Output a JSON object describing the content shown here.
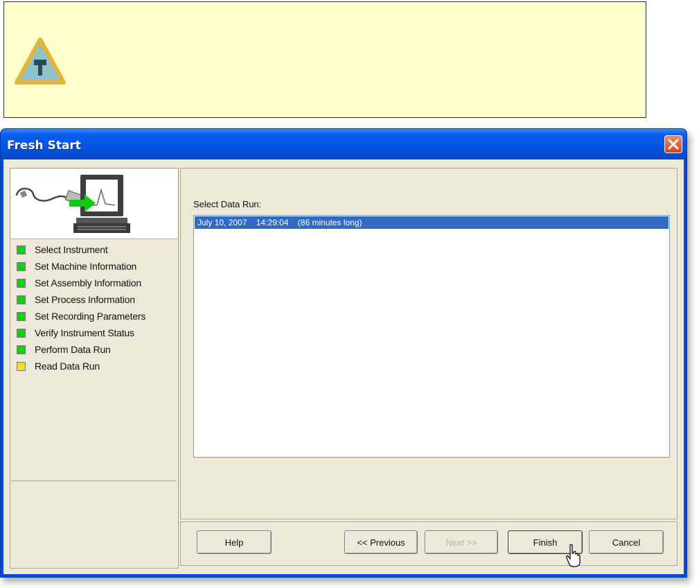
{
  "note": {
    "icon": "hammer-tip-icon"
  },
  "dialog": {
    "title": "Fresh Start",
    "close_icon": "close-icon"
  },
  "steps": [
    {
      "label": "Select Instrument",
      "status": "complete",
      "color": "#10d010"
    },
    {
      "label": "Set Machine Information",
      "status": "complete",
      "color": "#10d010"
    },
    {
      "label": "Set Assembly Information",
      "status": "complete",
      "color": "#10d010"
    },
    {
      "label": "Set Process Information",
      "status": "complete",
      "color": "#10d010"
    },
    {
      "label": "Set Recording Parameters",
      "status": "complete",
      "color": "#10d010"
    },
    {
      "label": "Verify Instrument Status",
      "status": "complete",
      "color": "#10d010"
    },
    {
      "label": "Perform Data Run",
      "status": "complete",
      "color": "#10d010"
    },
    {
      "label": "Read Data Run",
      "status": "current",
      "color": "#f0e020"
    }
  ],
  "data_run": {
    "label": "Select Data Run:",
    "items": [
      {
        "text": "July 10, 2007    14:29:04    (86 minutes long)",
        "selected": true
      }
    ]
  },
  "buttons": {
    "help": "Help",
    "previous": "<< Previous",
    "next": "Next >>",
    "finish": "Finish",
    "cancel": "Cancel"
  },
  "colors": {
    "title_bar": "#0653e2",
    "selection": "#316ac5",
    "note_background": "#ffffcc",
    "dialog_background": "#ece9d8"
  }
}
